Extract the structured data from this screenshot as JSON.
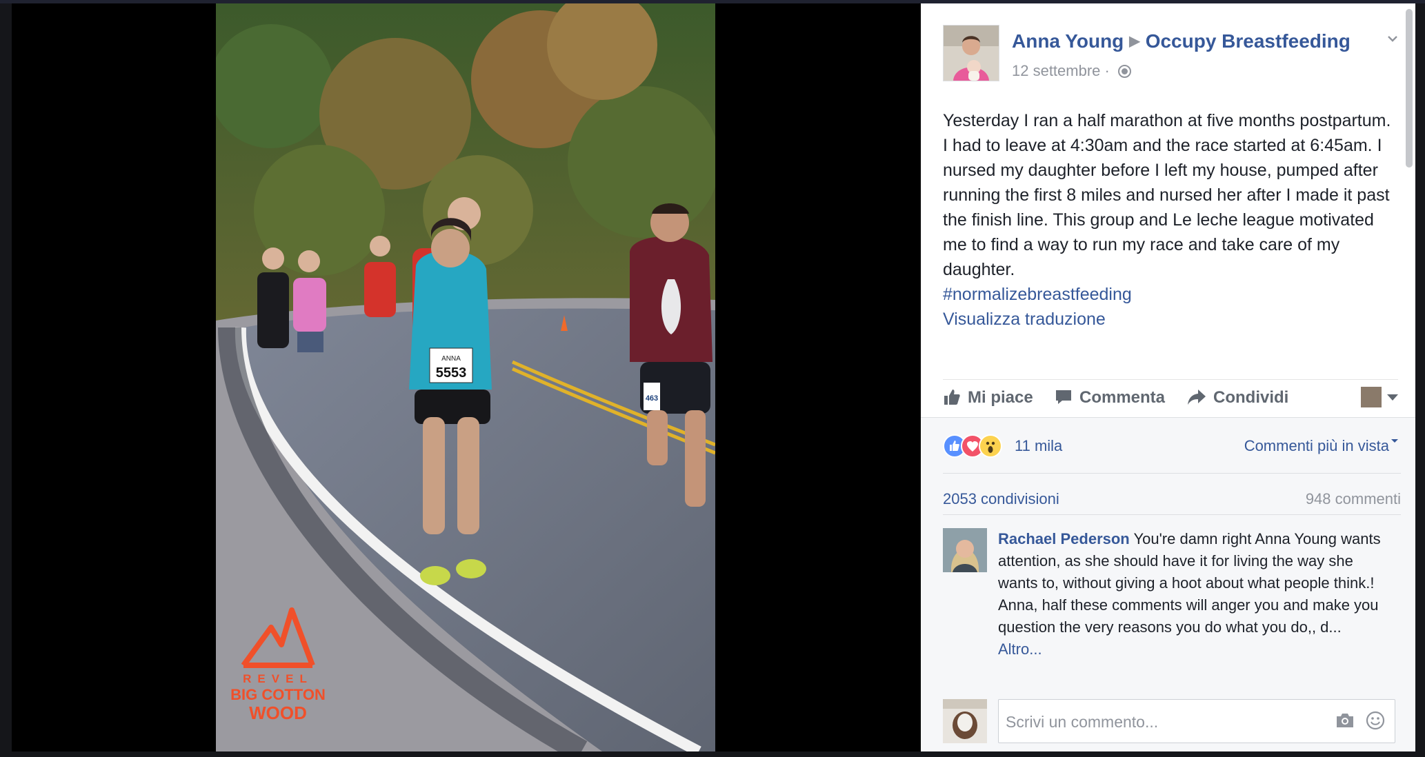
{
  "post": {
    "author": "Anna Young",
    "group": "Occupy Breastfeeding",
    "date": "12 settembre",
    "date_separator": "·",
    "body": "Yesterday I ran a half marathon at five months postpartum. I had to leave at 4:30am and the race started at 6:45am. I nursed my daughter before I left my house, pumped after running the first 8 miles and nursed her after I made it past the finish line. This group and Le leche league motivated me to find a way to run my race and take care of my daughter.",
    "hashtag": "#normalizebreastfeeding",
    "translate": "Visualizza traduzione"
  },
  "photo": {
    "bib_name": "ANNA",
    "bib_number": "5553",
    "side_bib_number": "463",
    "logo_lines": [
      "REVEL",
      "BIG COTTON",
      "WOOD"
    ]
  },
  "actions": {
    "like": "Mi piace",
    "comment": "Commenta",
    "share": "Condividi"
  },
  "feedback": {
    "reactions_count": "11 mila",
    "top_comments": "Commenti più in vista",
    "shares": "2053 condivisioni",
    "comments": "948 commenti"
  },
  "comment": {
    "author": "Rachael Pederson",
    "text": "You're damn right Anna Young wants attention, as she should have it for living the way she wants to, without giving a hoot about what people think.! Anna, half these comments will anger you and make you question the very reasons you do what you do,, d...",
    "more": "Altro..."
  },
  "composer": {
    "placeholder": "Scrivi un commento..."
  },
  "colors": {
    "link": "#365899",
    "text": "#1d2129",
    "muted": "#90949c",
    "logo_orange": "#f0502a"
  }
}
